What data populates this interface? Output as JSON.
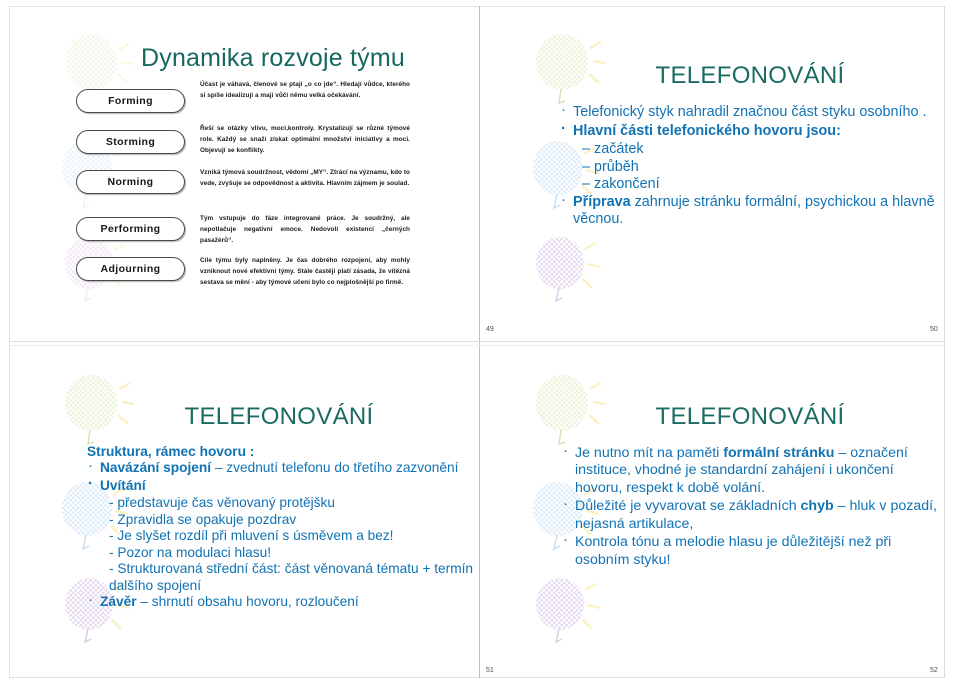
{
  "document": {
    "type": "presentation-handout",
    "slides_per_page": 4,
    "colors": {
      "title_green": "#16685e",
      "body_blue": "#1173b4",
      "stage_text": "#16161a",
      "page_number": "#4d4d4d"
    }
  },
  "slides": [
    {
      "page_number": "49",
      "title": "Dynamika rozvoje týmu",
      "stages": [
        {
          "label": "Forming",
          "description": "Účast je váhavá, členové se ptají „o co jde“. Hledají vůdce, kterého si spíše idealizují a mají vůči němu velká očekávání."
        },
        {
          "label": "Storming",
          "description": "Řeší se otázky vlivu, moci,kontroly. Krystalizují se různé týmové role. Každý se snaží získat optimální množství iniciativy a moci. Objevují se konflikty."
        },
        {
          "label": "Norming",
          "description": "Vzniká týmová soudržnost, vědomí „MY“. Ztrácí na významu, kdo to vede, zvyšuje se odpovědnost a aktivita. Hlavním zájmem je soulad."
        },
        {
          "label": "Performing",
          "description": "Tým vstupuje do fáze integrované práce. Je soudržný, ale nepotlačuje negativní emoce. Nedovolí existenci „černých pasažérů“."
        },
        {
          "label": "Adjourning",
          "description": "Cíle týmu byly naplněny. Je čas dobrého rozpojení, aby mohly vzniknout nové efektivní týmy. Stále častěji platí zásada, že vítězná sestava se mění - aby týmové učení bylo co nejplošnější po firmě."
        }
      ]
    },
    {
      "page_number": "50",
      "title": "TELEFONOVÁNÍ",
      "lines": [
        {
          "kind": "bullet",
          "text": "Telefonický styk nahradil značnou část styku osobního ."
        },
        {
          "kind": "bullet",
          "bold": "Hlavní části telefonického hovoru jsou:"
        },
        {
          "kind": "dash",
          "text": "– začátek"
        },
        {
          "kind": "dash",
          "text": "– průběh"
        },
        {
          "kind": "dash",
          "text": "– zakončení"
        },
        {
          "kind": "bullet",
          "bold": "Příprava",
          "text": " zahrnuje stránku formální, psychickou a hlavně věcnou."
        }
      ]
    },
    {
      "page_number": "51",
      "title": "TELEFONOVÁNÍ",
      "lines": [
        {
          "kind": "plain",
          "bold": "Struktura, rámec hovoru :"
        },
        {
          "kind": "bullet",
          "bold": "Navázání spojení",
          "text": " – zvednutí telefonu do třetího zazvonění"
        },
        {
          "kind": "bullet",
          "bold": "Uvítání"
        },
        {
          "kind": "dash",
          "text": "- představuje čas věnovaný protějšku"
        },
        {
          "kind": "dash",
          "text": "- Zpravidla se opakuje pozdrav"
        },
        {
          "kind": "dash",
          "text": "- Je slyšet rozdíl při mluvení s úsměvem a bez!"
        },
        {
          "kind": "dash",
          "text": "- Pozor na modulaci hlasu!"
        },
        {
          "kind": "dash-wrap",
          "text": "- Strukturovaná střední část: část věnovaná tématu + termín dalšího spojení"
        },
        {
          "kind": "bullet",
          "bold": "Závěr",
          "text": " – shrnutí obsahu hovoru, rozloučení"
        }
      ]
    },
    {
      "page_number": "52",
      "title": "TELEFONOVÁNÍ",
      "lines": [
        {
          "kind": "bullet",
          "text": "Je nutno mít na paměti ",
          "bold": "formální stránku",
          "text2": " – označení instituce, vhodné je standardní zahájení i ukončení hovoru, respekt k době volání."
        },
        {
          "kind": "bullet",
          "text": "Důležité je vyvarovat se základních ",
          "bold": "chyb",
          "text2": " – hluk v pozadí, nejasná artikulace,"
        },
        {
          "kind": "bullet",
          "text": "Kontrola tónu a melodie hlasu je důležitější než při osobním styku!"
        }
      ]
    }
  ],
  "decoration": {
    "name": "balloons-and-sparkles",
    "balloon_colors": [
      "#dfeec2",
      "#cfe4f3",
      "#ddd0e8"
    ],
    "sparkle_color": "#fdf4c0"
  }
}
